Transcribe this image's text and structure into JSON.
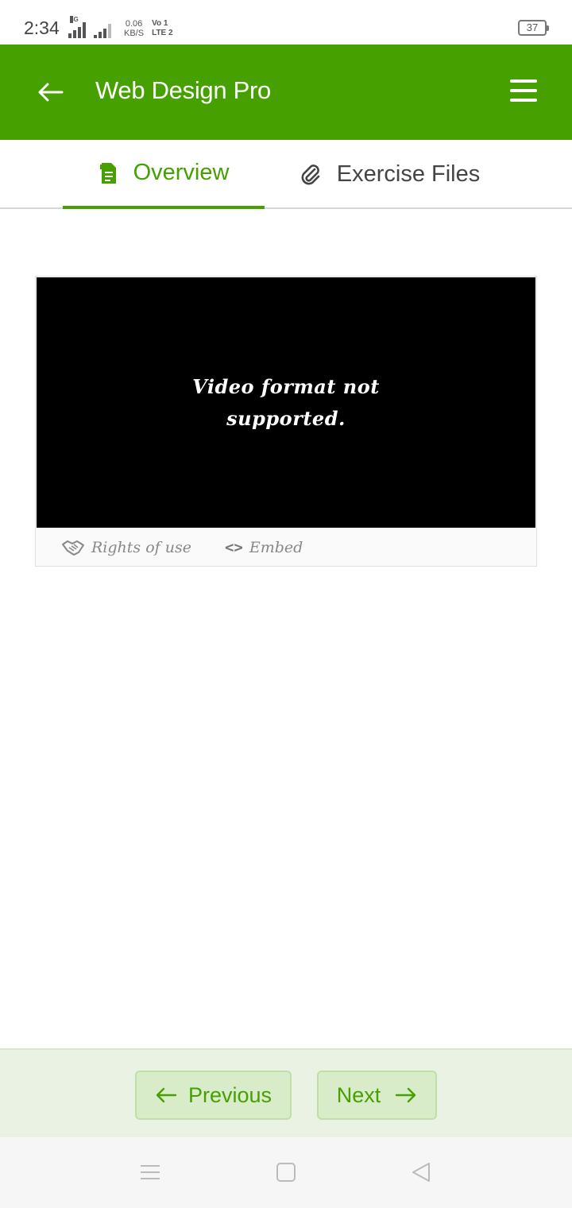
{
  "status_bar": {
    "time": "2:34",
    "network_type": "4G",
    "speed_value": "0.06",
    "speed_unit": "KB/S",
    "volte_top": "Vo 1",
    "volte_bottom": "LTE 2",
    "battery": "37"
  },
  "app_bar": {
    "title": "Web Design Pro",
    "back_icon": "arrow-left-icon",
    "menu_icon": "hamburger-menu-icon"
  },
  "tabs": [
    {
      "label": "Overview",
      "icon": "document-icon",
      "active": true
    },
    {
      "label": "Exercise Files",
      "icon": "paperclip-icon",
      "active": false
    }
  ],
  "video": {
    "message": "Video format not supported.",
    "links": [
      {
        "label": "Rights of use",
        "icon": "handshake-icon"
      },
      {
        "label": "Embed",
        "icon": "code-icon",
        "glyph": "<>"
      }
    ]
  },
  "navigation": {
    "previous_label": "Previous",
    "next_label": "Next"
  },
  "colors": {
    "accent": "#46a000",
    "nav_background": "#eaf3e3",
    "button_background": "#d9ecca"
  }
}
